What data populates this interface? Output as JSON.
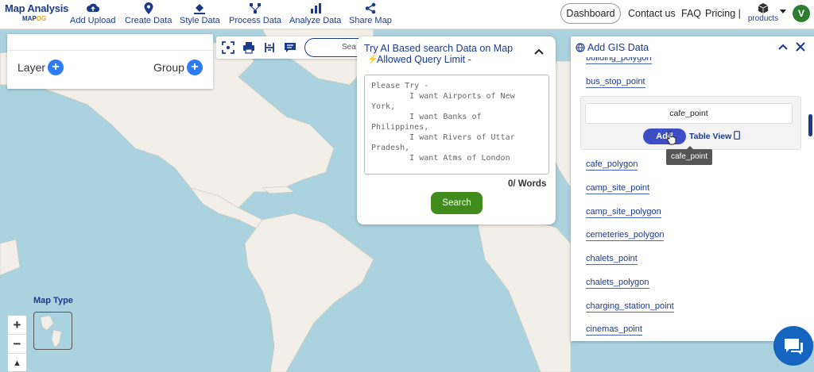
{
  "app": {
    "logo_title": "Map Analysis",
    "logo_sub_a": "MAP",
    "logo_sub_b": "OG"
  },
  "nav": [
    {
      "label": "Add Upload",
      "icon": "cloud-upload-icon"
    },
    {
      "label": "Create Data",
      "icon": "location-pin-icon"
    },
    {
      "label": "Style Data",
      "icon": "paint-bucket-icon"
    },
    {
      "label": "Process Data",
      "icon": "process-nodes-icon"
    },
    {
      "label": "Analyze Data",
      "icon": "analyze-chart-icon"
    },
    {
      "label": "Share Map",
      "icon": "share-icon"
    }
  ],
  "header_right": {
    "dashboard": "Dashboard",
    "contact": "Contact us",
    "faq": "FAQ",
    "pricing": "Pricing |",
    "products": "products",
    "avatar_initial": "V"
  },
  "layer_panel": {
    "layer_label": "Layer",
    "group_label": "Group"
  },
  "map_tools": {
    "search_text": "Sea"
  },
  "ai_panel": {
    "title": "Try AI Based search Data on Map",
    "subtitle": "Allowed Query Limit -",
    "placeholder": "Please Try -\n        I want Airports of New York,\n        I want Banks of Philippines,\n        I want Rivers of Uttar Pradesh,\n        I want Atms of London",
    "word_count": "0/ Words",
    "search_button": "Search"
  },
  "gis_panel": {
    "title": "Add GIS Data",
    "items_top": [
      "building_polygon",
      "bus_stop_point"
    ],
    "selected_item": "cafe_point",
    "add_button": "Add",
    "table_view": "Table View",
    "tooltip": "cafe_point",
    "items_bottom": [
      "cafe_polygon",
      "camp_site_point",
      "camp_site_polygon",
      "cemeteries_polygon",
      "chalets_point",
      "chalets_polygon",
      "charging_station_point",
      "cinemas_point"
    ]
  },
  "map": {
    "map_type_label": "Map Type",
    "zoom_in": "+",
    "zoom_out": "−",
    "compass": "▲"
  },
  "colors": {
    "brand": "#1c3a8a",
    "water": "#aad3df",
    "land": "#f2efe9",
    "search_green": "#3f8b1b",
    "add_blue": "#3b4ec5",
    "plus_blue": "#2f7bf5"
  }
}
